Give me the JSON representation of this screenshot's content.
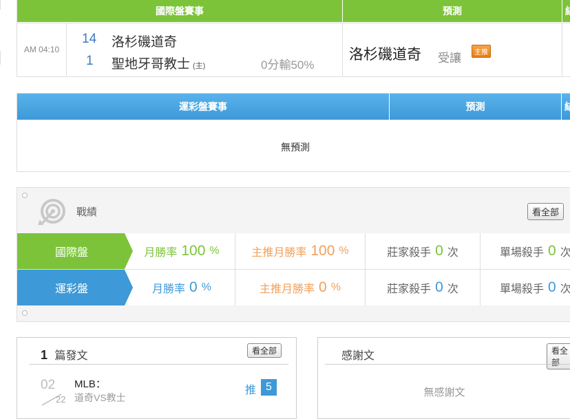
{
  "intl": {
    "header_match": "國際盤賽事",
    "header_pred": "預測",
    "header_extra": "結",
    "time": "AM 04:10",
    "away_score": "14",
    "away_team": "洛杉磯道奇",
    "home_score": "1",
    "home_team": "聖地牙哥教士",
    "home_tag": "(主)",
    "handicap": "0分輸50%",
    "pred_team": "洛杉磯道奇",
    "pred_dir": "受讓",
    "pred_badge": "主推"
  },
  "lottery": {
    "header_match": "運彩盤賽事",
    "header_pred": "預測",
    "header_extra": "結",
    "empty": "無預測"
  },
  "record": {
    "title": "戰績",
    "see_all": "看全部",
    "rows": [
      {
        "label": "國際盤",
        "month_rate_label": "月勝率",
        "month_rate": "100",
        "pct": "%",
        "main_rate_label": "主推月勝率",
        "main_rate": "100",
        "banker_label": "莊家殺手",
        "banker_count": "0",
        "times": "次",
        "single_label": "單場殺手",
        "single_count": "0",
        "single_times": "次"
      },
      {
        "label": "運彩盤",
        "month_rate_label": "月勝率",
        "month_rate": "0",
        "pct": "%",
        "main_rate_label": "主推月勝率",
        "main_rate": "0",
        "banker_label": "莊家殺手",
        "banker_count": "0",
        "times": "次",
        "single_label": "單場殺手",
        "single_count": "0",
        "single_times": "次"
      }
    ],
    "colors": {
      "green": "#7cc33a",
      "blue": "#3d99d8",
      "orange": "#f0a05a"
    }
  },
  "posts": {
    "count": "1",
    "title": "篇發文",
    "see_all": "看全部",
    "item": {
      "month": "02",
      "day": "22",
      "category": "MLB：",
      "subject": "道奇VS教士",
      "push_label": "推",
      "push_count": "5"
    }
  },
  "thanks": {
    "title": "感謝文",
    "see_all": "看全部",
    "empty": "無感謝文"
  }
}
